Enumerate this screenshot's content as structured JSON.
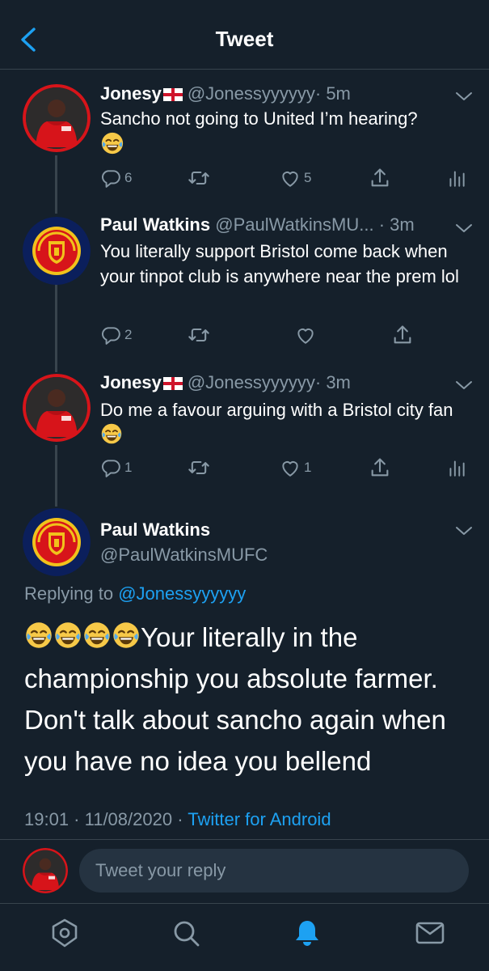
{
  "header": {
    "title": "Tweet"
  },
  "colors": {
    "background": "#15202b",
    "accent": "#1da1f2",
    "muted": "#8899a6",
    "divider": "#38444d"
  },
  "tweets": [
    {
      "name": "Jonesy",
      "handle": "@Jonessyyyyyy",
      "time": "· 5m",
      "text": "Sancho not going to United I’m hearing?",
      "replies": "6",
      "retweets": "",
      "likes": "5",
      "avatar": "jonesy"
    },
    {
      "name": "Paul Watkins",
      "handle": "@PaulWatkinsMU...",
      "time": "· 3m",
      "text": "You literally support Bristol come back when your tinpot club is anywhere near the prem lol",
      "replies": "2",
      "retweets": "",
      "likes": "",
      "avatar": "united-crest"
    },
    {
      "name": "Jonesy",
      "handle": "@Jonessyyyyyy",
      "time": "· 3m",
      "text": "Do me a favour arguing with a Bristol city fan",
      "replies": "1",
      "retweets": "",
      "likes": "1",
      "avatar": "jonesy"
    }
  ],
  "main_tweet": {
    "name": "Paul Watkins",
    "handle": "@PaulWatkinsMUFC",
    "replying_label": "Replying to",
    "replying_to": "@Jonessyyyyyy",
    "text": "Your literally in the championship you absolute farmer. Don't talk about sancho again when you have no idea you bellend",
    "time": "19:01 · 11/08/2020 ·",
    "source": "Twitter for Android"
  },
  "reply": {
    "placeholder": "Tweet your reply"
  },
  "tabs": [
    "home-icon",
    "search-icon",
    "notifications-icon",
    "messages-icon"
  ]
}
